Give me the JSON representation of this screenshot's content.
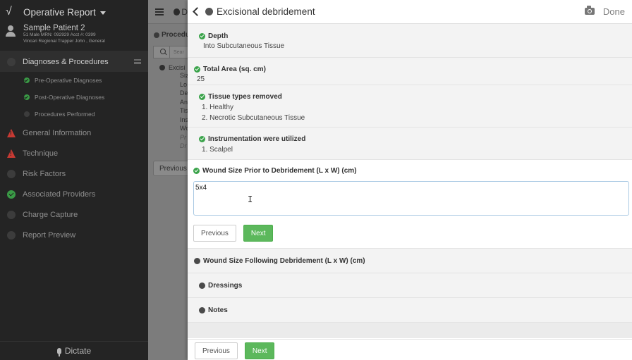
{
  "sidebar": {
    "app_title": "Operative Report",
    "patient": {
      "name": "Sample Patient 2",
      "line1": "51 Male MRN: 092929 Acct #: 0399",
      "line2": "Vincari Regional Trapper John , General"
    },
    "items": [
      {
        "label": "Diagnoses & Procedures",
        "status": "active"
      },
      {
        "label": "Pre-Operative Diagnoses",
        "status": "complete",
        "sub": true
      },
      {
        "label": "Post-Operative Diagnoses",
        "status": "complete",
        "sub": true
      },
      {
        "label": "Procedures Performed",
        "status": "pending",
        "sub": true
      },
      {
        "label": "General Information",
        "status": "warning"
      },
      {
        "label": "Technique",
        "status": "warning"
      },
      {
        "label": "Risk Factors",
        "status": "pending"
      },
      {
        "label": "Associated Providers",
        "status": "complete"
      },
      {
        "label": "Charge Capture",
        "status": "pending"
      },
      {
        "label": "Report Preview",
        "status": "pending"
      }
    ],
    "dictate_label": "Dictate"
  },
  "middle": {
    "title_fragment": "D",
    "section_label": "Procedu",
    "search_placeholder": "Sear",
    "procedure": "Excisi",
    "fields": [
      "Siz",
      "Lo",
      "De",
      "An",
      "Tis",
      "Ins",
      "Wo",
      "Pr",
      "Dr"
    ],
    "previous_label": "Previous"
  },
  "main": {
    "title": "Excisional debridement",
    "done_label": "Done",
    "depth": {
      "label": "Depth",
      "value": "Into Subcutaneous Tissue"
    },
    "total_area": {
      "label": "Total Area (sq. cm)",
      "value": "25"
    },
    "tissue_types": {
      "label": "Tissue types removed",
      "items": [
        "1.  Healthy",
        "2.  Necrotic Subcutaneous Tissue"
      ]
    },
    "instrumentation": {
      "label": "Instrumentation were utilized",
      "items": [
        "1.  Scalpel"
      ]
    },
    "wound_prior": {
      "label": "Wound Size Prior to Debridement (L x W) (cm)",
      "value": "5x4"
    },
    "previous_label": "Previous",
    "next_label": "Next",
    "wound_following": {
      "label": "Wound Size Following Debridement (L x W) (cm)"
    },
    "dressings": {
      "label": "Dressings"
    },
    "notes": {
      "label": "Notes"
    },
    "footer_previous_label": "Previous",
    "footer_next_label": "Next"
  }
}
